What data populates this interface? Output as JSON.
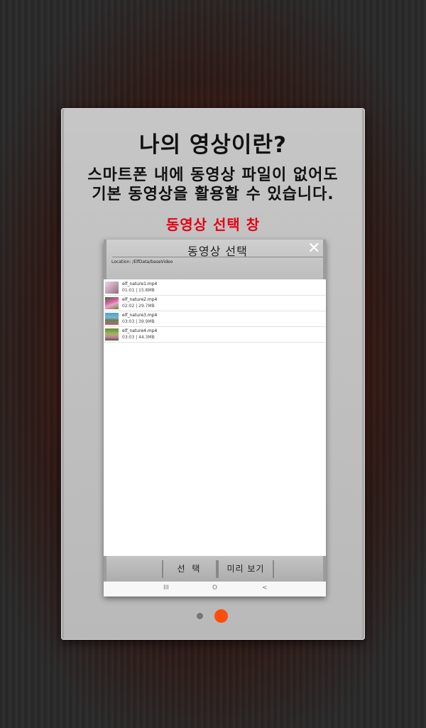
{
  "headline": "나의 영상이란?",
  "description_line1": "스마트폰 내에 동영상 파일이 없어도",
  "description_line2": "기본 동영상을 활용할 수 있습니다.",
  "caption": "동영상 선택 창",
  "dialog": {
    "title": "동영상 선택",
    "close_icon": "close-icon",
    "location": "Location: /ElfData/baseVideo",
    "files": [
      {
        "name": "elf_nature1.mp4",
        "meta": "01:01 | 15.8MB"
      },
      {
        "name": "elf_nature2.mp4",
        "meta": "02:02 | 29.7MB"
      },
      {
        "name": "elf_nature3.mp4",
        "meta": "03:03 | 39.9MB"
      },
      {
        "name": "elf_nature4.mp4",
        "meta": "03:03 | 44.3MB"
      }
    ],
    "select_button": "선 택",
    "preview_button": "미리 보기",
    "nav": {
      "recents": "III",
      "home": "O",
      "back": "<"
    }
  },
  "pagination": {
    "pages": 2,
    "current": 2
  },
  "colors": {
    "caption": "#e60012",
    "active_dot": "#ff4e0a",
    "inactive_dot": "#777777"
  }
}
